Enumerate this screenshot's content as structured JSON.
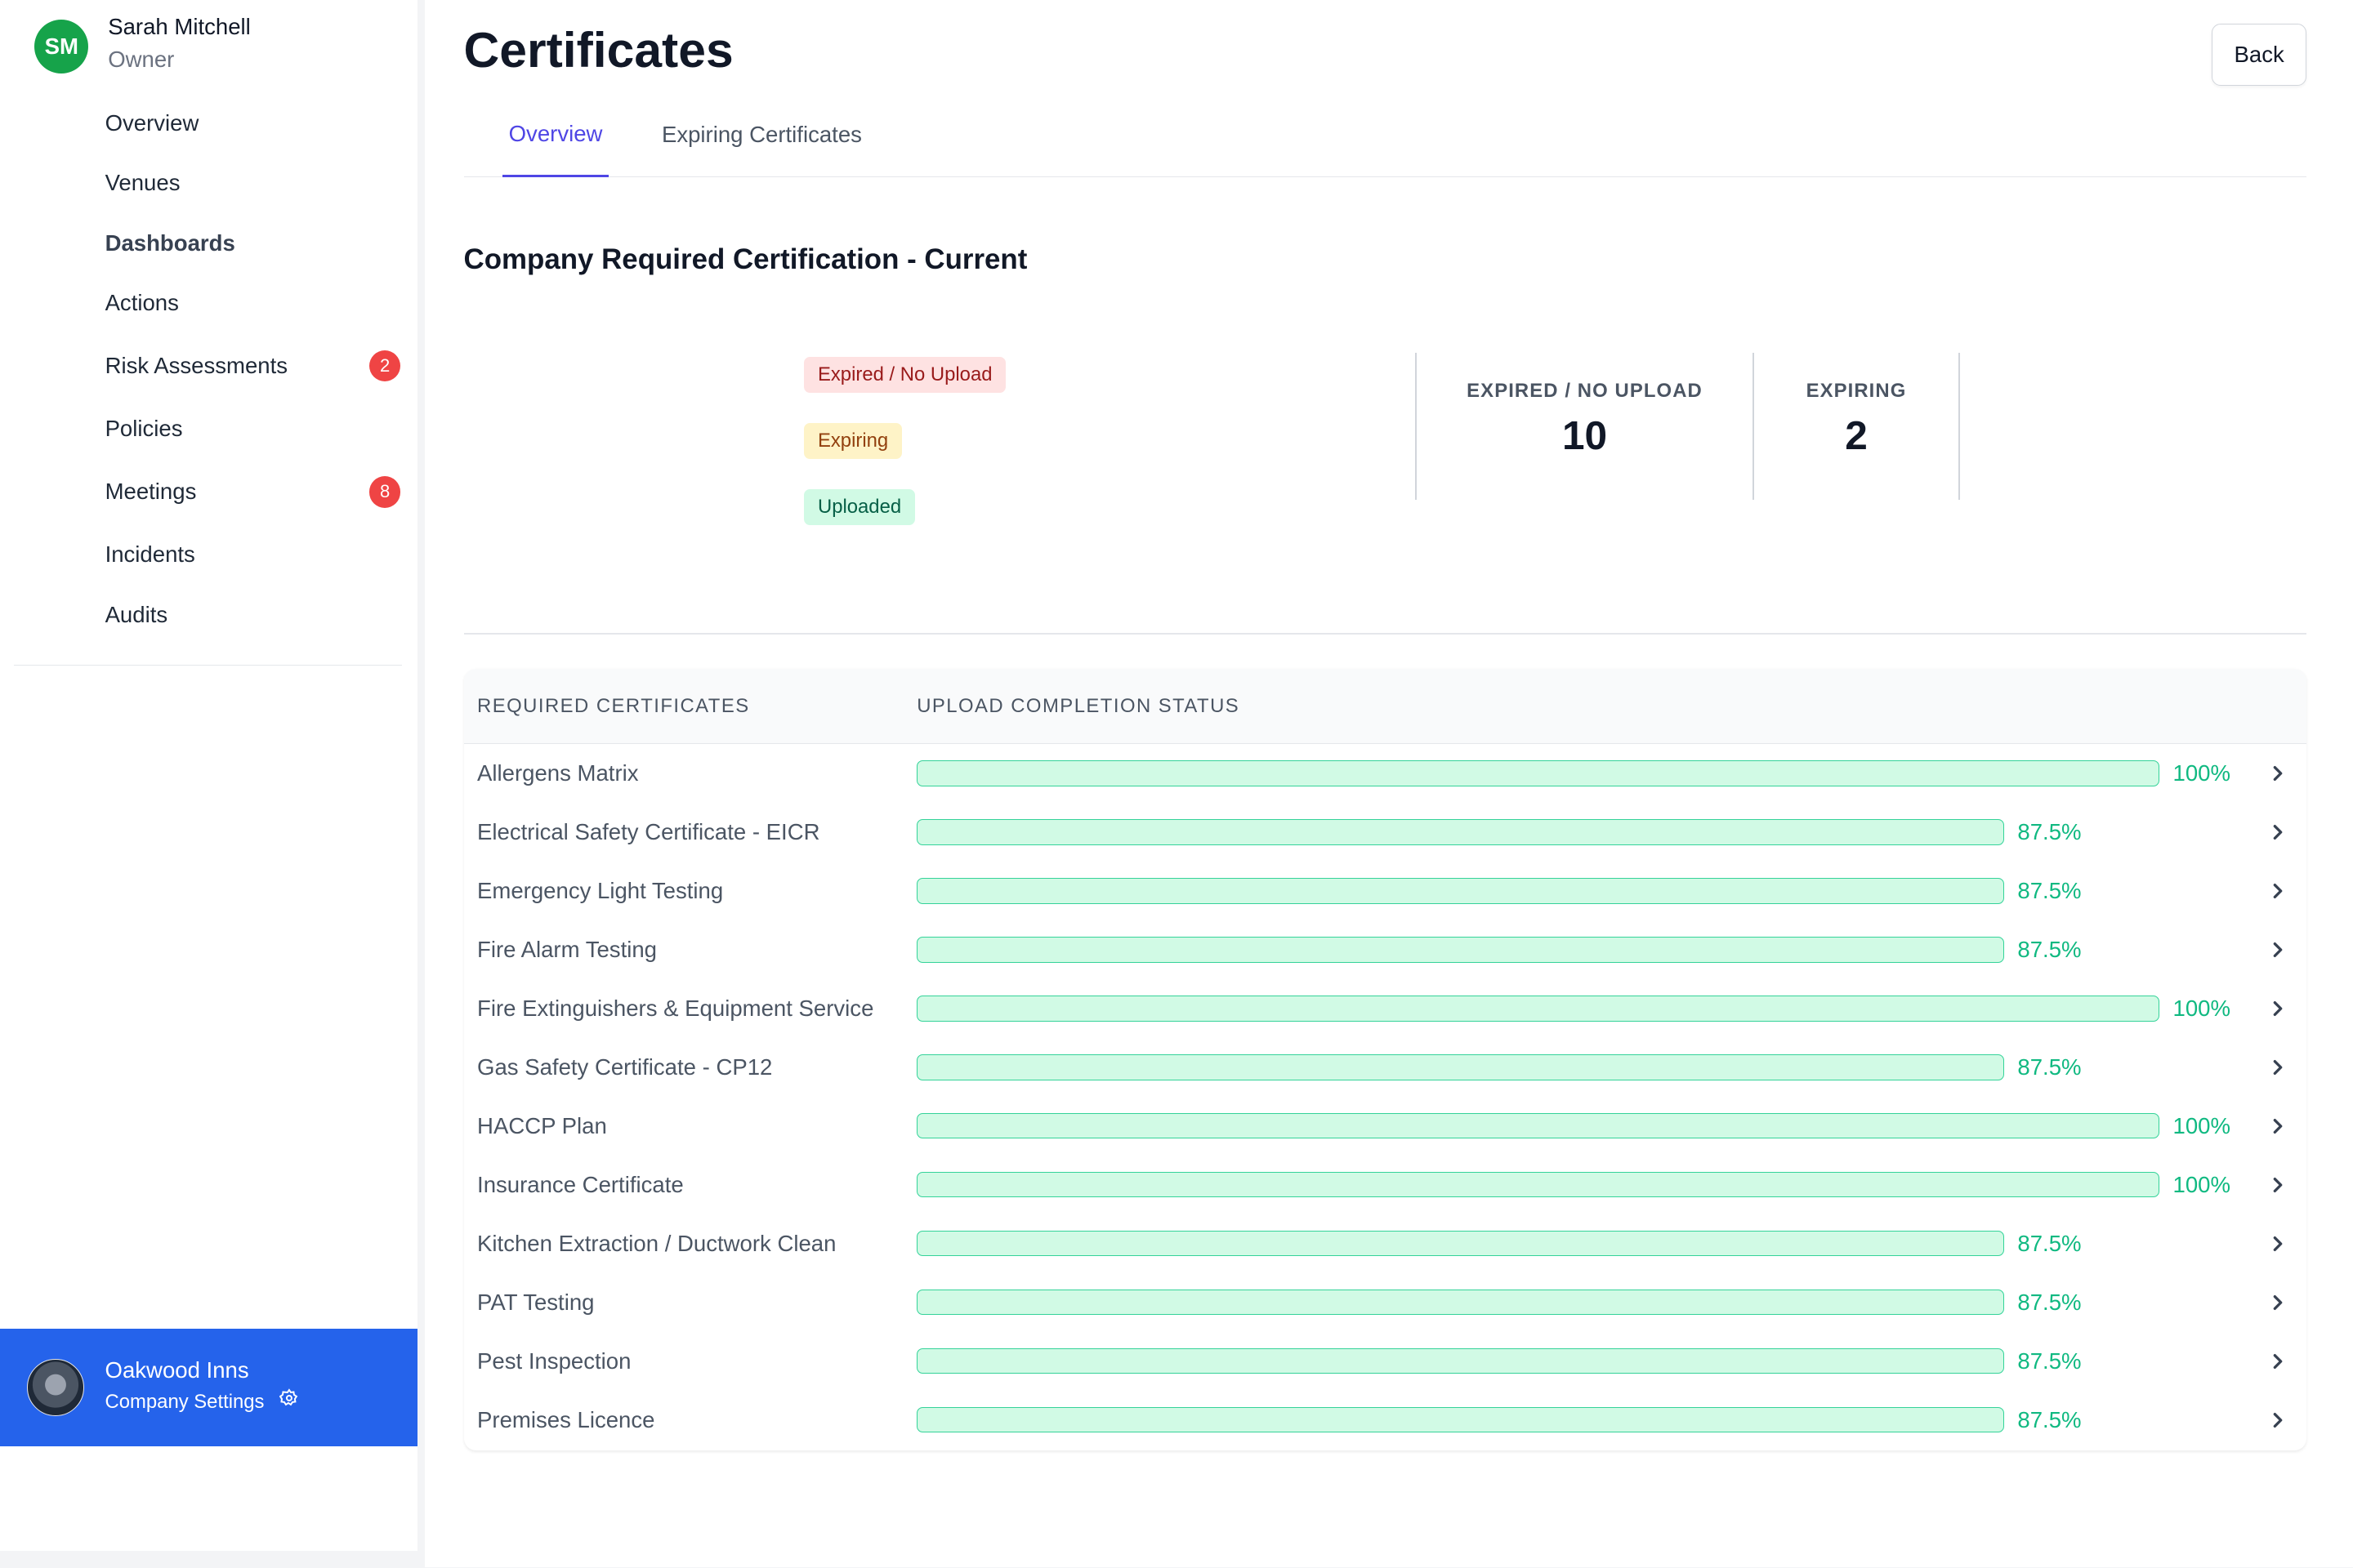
{
  "user": {
    "initials": "SM",
    "name": "Sarah Mitchell",
    "role": "Owner"
  },
  "nav": [
    {
      "label": "Overview"
    },
    {
      "label": "Venues"
    },
    {
      "label": "Dashboards",
      "active": true
    },
    {
      "label": "Actions"
    },
    {
      "label": "Risk Assessments",
      "badge": "2"
    },
    {
      "label": "Policies"
    },
    {
      "label": "Meetings",
      "badge": "8"
    },
    {
      "label": "Incidents"
    },
    {
      "label": "Audits"
    }
  ],
  "company": {
    "name": "Oakwood Inns",
    "settings_label": "Company Settings"
  },
  "page": {
    "title": "Certificates",
    "back_label": "Back"
  },
  "tabs": [
    {
      "label": "Overview",
      "active": true
    },
    {
      "label": "Expiring Certificates"
    }
  ],
  "section_title": "Company Required Certification - Current",
  "legend": [
    {
      "label": "Expired / No Upload",
      "color": "#fee2e2"
    },
    {
      "label": "Expiring",
      "color": "#fef3c7"
    },
    {
      "label": "Uploaded",
      "color": "#d1fae5"
    }
  ],
  "stats": [
    {
      "label": "EXPIRED / NO UPLOAD",
      "value": "10"
    },
    {
      "label": "EXPIRING",
      "value": "2"
    }
  ],
  "table": {
    "headers": [
      "REQUIRED CERTIFICATES",
      "UPLOAD COMPLETION STATUS"
    ],
    "rows": [
      {
        "name": "Allergens Matrix",
        "percent": 100,
        "percent_label": "100%"
      },
      {
        "name": "Electrical Safety Certificate - EICR",
        "percent": 87.5,
        "percent_label": "87.5%"
      },
      {
        "name": "Emergency Light Testing",
        "percent": 87.5,
        "percent_label": "87.5%"
      },
      {
        "name": "Fire Alarm Testing",
        "percent": 87.5,
        "percent_label": "87.5%"
      },
      {
        "name": "Fire Extinguishers & Equipment Service",
        "percent": 100,
        "percent_label": "100%"
      },
      {
        "name": "Gas Safety Certificate - CP12",
        "percent": 87.5,
        "percent_label": "87.5%"
      },
      {
        "name": "HACCP Plan",
        "percent": 100,
        "percent_label": "100%"
      },
      {
        "name": "Insurance Certificate",
        "percent": 100,
        "percent_label": "100%"
      },
      {
        "name": "Kitchen Extraction / Ductwork Clean",
        "percent": 87.5,
        "percent_label": "87.5%"
      },
      {
        "name": "PAT Testing",
        "percent": 87.5,
        "percent_label": "87.5%"
      },
      {
        "name": "Pest Inspection",
        "percent": 87.5,
        "percent_label": "87.5%"
      },
      {
        "name": "Premises Licence",
        "percent": 87.5,
        "percent_label": "87.5%"
      }
    ]
  },
  "colors": {
    "accent": "#4f46e5",
    "company_bg": "#2563eb",
    "success": "#10b981",
    "danger": "#ef4444"
  }
}
